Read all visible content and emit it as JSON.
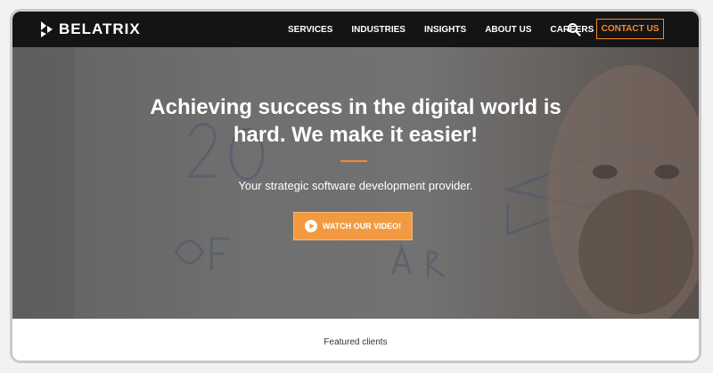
{
  "brand": {
    "name": "BELATRIX",
    "logo_icon": "diamond-grid-icon"
  },
  "nav": {
    "items": [
      {
        "label": "SERVICES"
      },
      {
        "label": "INDUSTRIES"
      },
      {
        "label": "INSIGHTS"
      },
      {
        "label": "ABOUT US"
      },
      {
        "label": "CAREERS"
      }
    ],
    "search_icon": "search-icon",
    "contact_label": "CONTACT US"
  },
  "hero": {
    "headline": "Achieving success in the digital world is hard. We make it easier!",
    "subtitle": "Your strategic software development provider.",
    "video_button_label": "WATCH OUR VIDEO!",
    "video_icon": "play-icon"
  },
  "featured": {
    "label": "Featured clients"
  },
  "colors": {
    "accent": "#f08a2c",
    "navbar_bg": "#141414",
    "text_light": "#ffffff"
  }
}
